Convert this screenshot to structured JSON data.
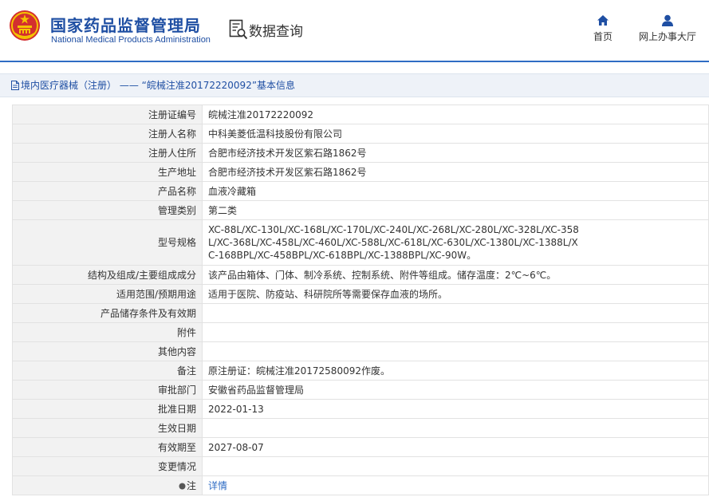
{
  "header": {
    "org_name_cn": "国家药品监督管理局",
    "org_name_en": "National Medical Products Administration",
    "section_title": "数据查询",
    "nav": [
      {
        "label": "首页",
        "icon": "home-icon"
      },
      {
        "label": "网上办事大厅",
        "icon": "user-icon"
      }
    ]
  },
  "breadcrumb": {
    "text": "境内医疗器械（注册） —— “皖械注准20172220092”基本信息"
  },
  "colors": {
    "brand": "#1f4fa3",
    "emblem_red": "#d32f2f",
    "emblem_gold": "#f5c400",
    "link": "#2f6cc4",
    "label_bg": "#f2f2f2"
  },
  "rows": [
    {
      "label": "注册证编号",
      "value": "皖械注准20172220092"
    },
    {
      "label": "注册人名称",
      "value": "中科美菱低温科技股份有限公司"
    },
    {
      "label": "注册人住所",
      "value": "合肥市经济技术开发区紫石路1862号"
    },
    {
      "label": "生产地址",
      "value": "合肥市经济技术开发区紫石路1862号"
    },
    {
      "label": "产品名称",
      "value": "血液冷藏箱"
    },
    {
      "label": "管理类别",
      "value": "第二类"
    },
    {
      "label": "型号规格",
      "lines": [
        "XC-88L/XC-130L/XC-168L/XC-170L/XC-240L/XC-268L/XC-280L/XC-328L/XC-358",
        "L/XC-368L/XC-458L/XC-460L/XC-588L/XC-618L/XC-630L/XC-1380L/XC-1388L/X",
        "C-168BPL/XC-458BPL/XC-618BPL/XC-1388BPL/XC-90W。"
      ]
    },
    {
      "label": "结构及组成/主要组成成分",
      "value": "该产品由箱体、门体、制冷系统、控制系统、附件等组成。储存温度：2℃~6℃。"
    },
    {
      "label": "适用范围/预期用途",
      "value": "适用于医院、防疫站、科研院所等需要保存血液的场所。"
    },
    {
      "label": "产品储存条件及有效期",
      "value": ""
    },
    {
      "label": "附件",
      "value": ""
    },
    {
      "label": "其他内容",
      "value": ""
    },
    {
      "label": "备注",
      "value": "原注册证：皖械注准20172580092作废。"
    },
    {
      "label": "审批部门",
      "value": "安徽省药品监督管理局"
    },
    {
      "label": "批准日期",
      "value": "2022-01-13"
    },
    {
      "label": "生效日期",
      "value": ""
    },
    {
      "label": "有效期至",
      "value": "2027-08-07"
    },
    {
      "label": "变更情况",
      "value": ""
    },
    {
      "label": "注",
      "value": "详情"
    }
  ]
}
